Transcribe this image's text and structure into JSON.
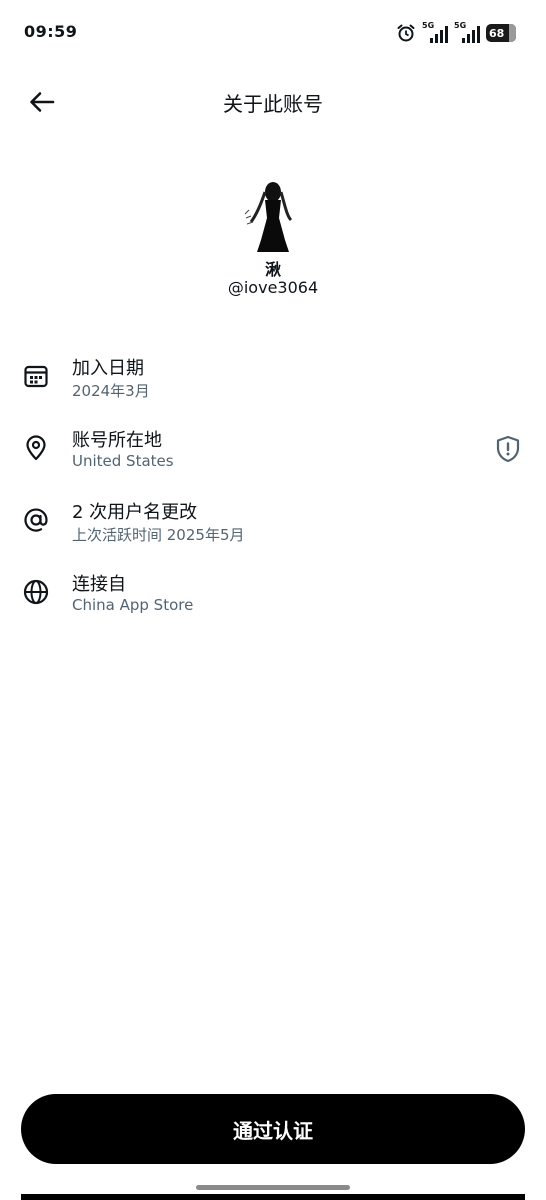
{
  "status_bar": {
    "time": "09:59",
    "network_1": "5G",
    "network_2": "5G",
    "battery": "68"
  },
  "header": {
    "title": "关于此账号"
  },
  "profile": {
    "display_name": "湫",
    "handle": "@iove3064"
  },
  "info_rows": [
    {
      "icon": "calendar-icon",
      "title": "加入日期",
      "subtitle": "2024年3月"
    },
    {
      "icon": "location-pin-icon",
      "title": "账号所在地",
      "subtitle": "United States",
      "trailing_icon": "shield-icon"
    },
    {
      "icon": "at-sign-icon",
      "title": "2 次用户名更改",
      "subtitle": "上次活跃时间 2025年5月"
    },
    {
      "icon": "globe-icon",
      "title": "连接自",
      "subtitle": "China App Store"
    }
  ],
  "actions": {
    "verify_label": "通过认证"
  },
  "colors": {
    "primary_text": "#0f1419",
    "secondary_text": "#536471",
    "button_bg": "#000000"
  }
}
